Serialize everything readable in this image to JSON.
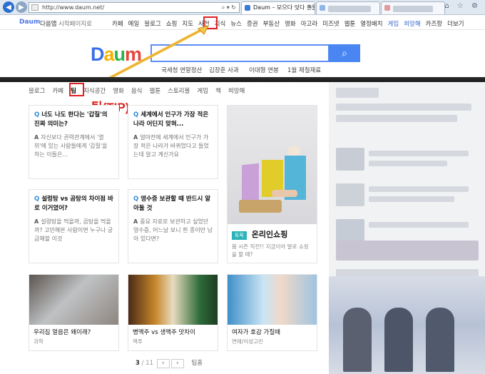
{
  "browser": {
    "url": "http://www.daum.net/",
    "tab_active": "Daum – 모으다 잇다 흔들다",
    "tab_close": "×",
    "window_icons": "⌂ ☆ ⚙",
    "back_icon": "back-arrow-icon",
    "forward_icon": "forward-arrow-icon",
    "address_tools": "⌕ ▾ ↻"
  },
  "topbar": {
    "logo": "Daum",
    "left_links": [
      "다음앱",
      "시작페이지로"
    ],
    "menu": [
      "카페",
      "메일",
      "블로그",
      "쇼핑",
      "지도",
      "사전",
      "지식",
      "뉴스",
      "증권",
      "부동산",
      "영화",
      "아고라",
      "미즈넷",
      "웹툰",
      "열정배치",
      "게임",
      "희망해",
      "카즈팡",
      "더보기"
    ]
  },
  "search": {
    "logo": "Daum",
    "button_icon": "search-icon",
    "button_glyph": "⌕",
    "suggestions": [
      "국세청 연말정산",
      "김장훈 사과",
      "이대형 연봉",
      "1월 제철재료"
    ]
  },
  "subnav": [
    "블로그",
    "카페",
    "팁",
    "지식공간",
    "영화",
    "음식",
    "웹툰",
    "스토리볼",
    "게임",
    "책",
    "희망해"
  ],
  "annotation": {
    "tip_label": "팁(TIP)"
  },
  "cards": [
    {
      "q": "너도 나도 한다는 '갑질'의 진짜 의미는?",
      "a": "자신보다 권력관계에서 '열위'에 있는 사람들에게 '갑질'을 하는 이들은..."
    },
    {
      "q": "세계에서 인구가 가장 적은 나라 어딘지 맞혀...",
      "a": "얼마전에 세계에서 인구가 가장 적은 나라가 바뀌었다고 들었는데 알고 계신가요"
    },
    {
      "q": "설렁탕 vs 곰탕의 차이점 바로 이거였어?",
      "a": "설렁탕을 먹을까, 곰탕을 먹을까? 고민해본 사람이면 누구나 궁금해할 이것"
    },
    {
      "q": "영수증 보관할 때 반드시 알아둘 것",
      "a": "중요 자료로 보관하고 싶었던 영수증, 어느날 보니 흰 종이만 남아 있다면?"
    }
  ],
  "feature": {
    "tag": "토픽",
    "title": "온리인쇼핑",
    "desc": "봄 시즌 직전!! 지금이야 말로 쇼핑을 할 때?"
  },
  "image_cards": [
    {
      "title": "우리집 얼음은 왜이래?",
      "sub": "과학"
    },
    {
      "title": "병맥주 vs 생맥주 맛차이",
      "sub": "맥주"
    },
    {
      "title": "여자가 호감 가질때",
      "sub": "연애/이성고민"
    }
  ],
  "pager": {
    "current": "3",
    "total": "11",
    "prev": "‹",
    "next": "›",
    "more": "팁홈"
  }
}
